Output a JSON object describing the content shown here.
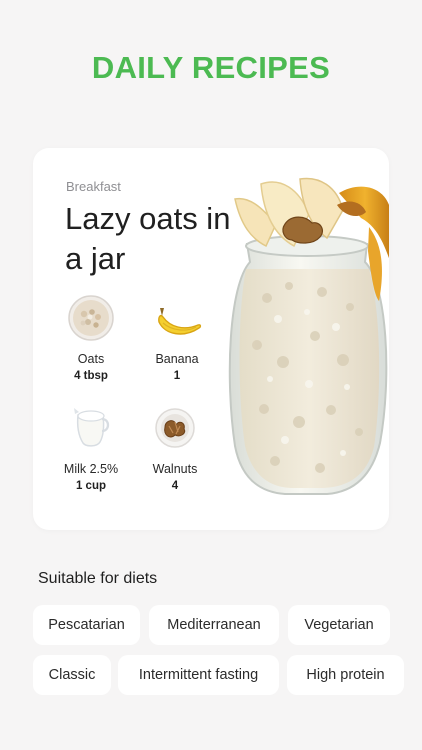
{
  "header": {
    "title": "DAILY RECIPES"
  },
  "recipe": {
    "meal_type": "Breakfast",
    "title": "Lazy oats in a jar",
    "ingredients": [
      {
        "name": "Oats",
        "amount": "4 tbsp",
        "icon": "oats-bowl-icon"
      },
      {
        "name": "Banana",
        "amount": "1",
        "icon": "banana-icon"
      },
      {
        "name": "Milk 2.5%",
        "amount": "1 cup",
        "icon": "milk-jug-icon"
      },
      {
        "name": "Walnuts",
        "amount": "4",
        "icon": "walnuts-bowl-icon"
      }
    ],
    "image": "oats-jar-image"
  },
  "diets": {
    "title": "Suitable for diets",
    "chips": [
      "Pescatarian",
      "Mediterranean",
      "Vegetarian",
      "Classic",
      "Intermittent fasting",
      "High protein"
    ]
  },
  "colors": {
    "accent": "#4cba52",
    "background": "#f6f5f5",
    "card": "#ffffff"
  }
}
